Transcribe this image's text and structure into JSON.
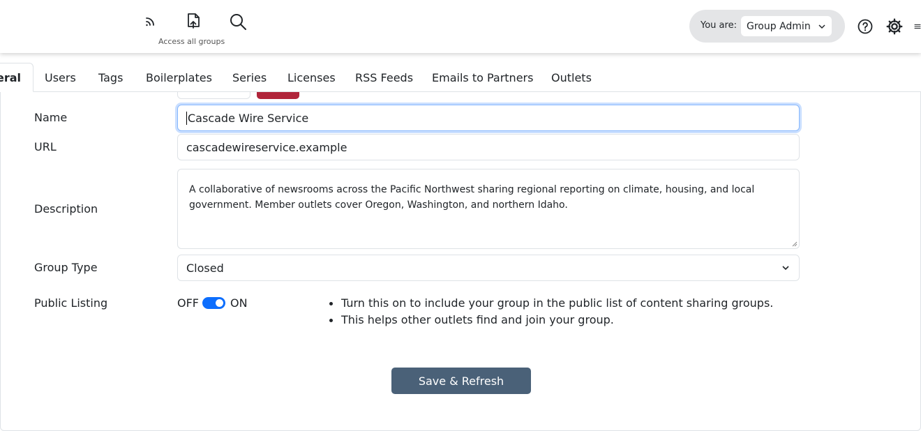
{
  "header": {
    "access_all_groups_label": "Access all groups",
    "role_label": "You are:",
    "role_value": "Group Admin"
  },
  "tabs": [
    {
      "label": "General",
      "active": true
    },
    {
      "label": "Users"
    },
    {
      "label": "Tags"
    },
    {
      "label": "Boilerplates"
    },
    {
      "label": "Series"
    },
    {
      "label": "Licenses"
    },
    {
      "label": "RSS Feeds"
    },
    {
      "label": "Emails to Partners"
    },
    {
      "label": "Outlets"
    }
  ],
  "form": {
    "name_label": "Name",
    "name_value": "Cascade Wire Service",
    "url_label": "URL",
    "url_value": "cascadewireservice.example",
    "description_label": "Description",
    "description_value": "A collaborative of newsrooms across the Pacific Northwest sharing regional reporting on climate, housing, and local government. Member outlets cover Oregon, Washington, and northern Idaho.",
    "group_type_label": "Group Type",
    "group_type_value": "Closed",
    "public_listing_label": "Public Listing",
    "toggle_off_label": "OFF",
    "toggle_on_label": "ON",
    "public_listing_on": true,
    "hints": [
      "Turn this on to include your group in the public list of content sharing groups.",
      "This helps other outlets find and join your group."
    ],
    "save_button": "Save & Refresh"
  },
  "colors": {
    "primary": "#0d6efd",
    "save_button": "#4a6178",
    "danger": "#b0243a",
    "pill_bg": "#e4e5e7"
  }
}
